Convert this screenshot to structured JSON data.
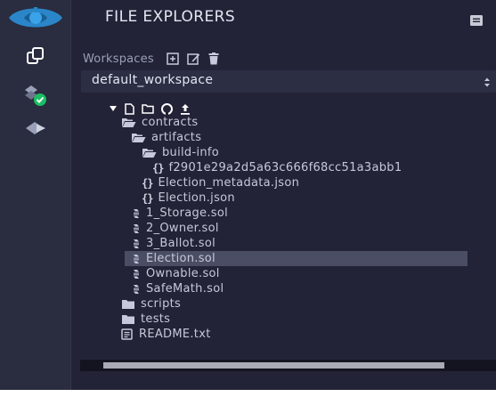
{
  "panel": {
    "title": "FILE EXPLORERS"
  },
  "workspaces": {
    "label": "Workspaces",
    "selected": "default_workspace"
  },
  "tree": {
    "folders": {
      "contracts": "contracts",
      "artifacts": "artifacts",
      "build_info": "build-info",
      "scripts": "scripts",
      "tests": "tests"
    },
    "files": {
      "build_info_json": "f2901e29a2d5a63c666f68cc51a3abb1",
      "election_metadata": "Election_metadata.json",
      "election_json": "Election.json",
      "storage": "1_Storage.sol",
      "owner": "2_Owner.sol",
      "ballot": "3_Ballot.sol",
      "election_sol": "Election.sol",
      "ownable": "Ownable.sol",
      "safemath": "SafeMath.sol",
      "readme": "README.txt"
    },
    "selected_file": "Election.sol"
  },
  "icons": {
    "logo": "remix-logo-icon",
    "files": "files-icon",
    "compiler": "solidity-compiler-icon",
    "deploy": "deploy-run-icon",
    "panel_menu": "panel-menu-icon",
    "create_workspace": "add-workspace-icon",
    "rename_workspace": "rename-workspace-icon",
    "delete_workspace": "delete-workspace-icon",
    "new_file": "new-file-icon",
    "new_folder": "new-folder-icon",
    "github": "github-icon",
    "upload": "upload-icon"
  },
  "colors": {
    "background": "#222336",
    "icon_bar": "#2a2c3f",
    "text": "#c6c9d9",
    "selection": "#4a4d64",
    "accent_logo": "#2a86c8",
    "check_green": "#1bbf63"
  },
  "scroll": {
    "horizontal_thumb_fraction": 0.82
  }
}
